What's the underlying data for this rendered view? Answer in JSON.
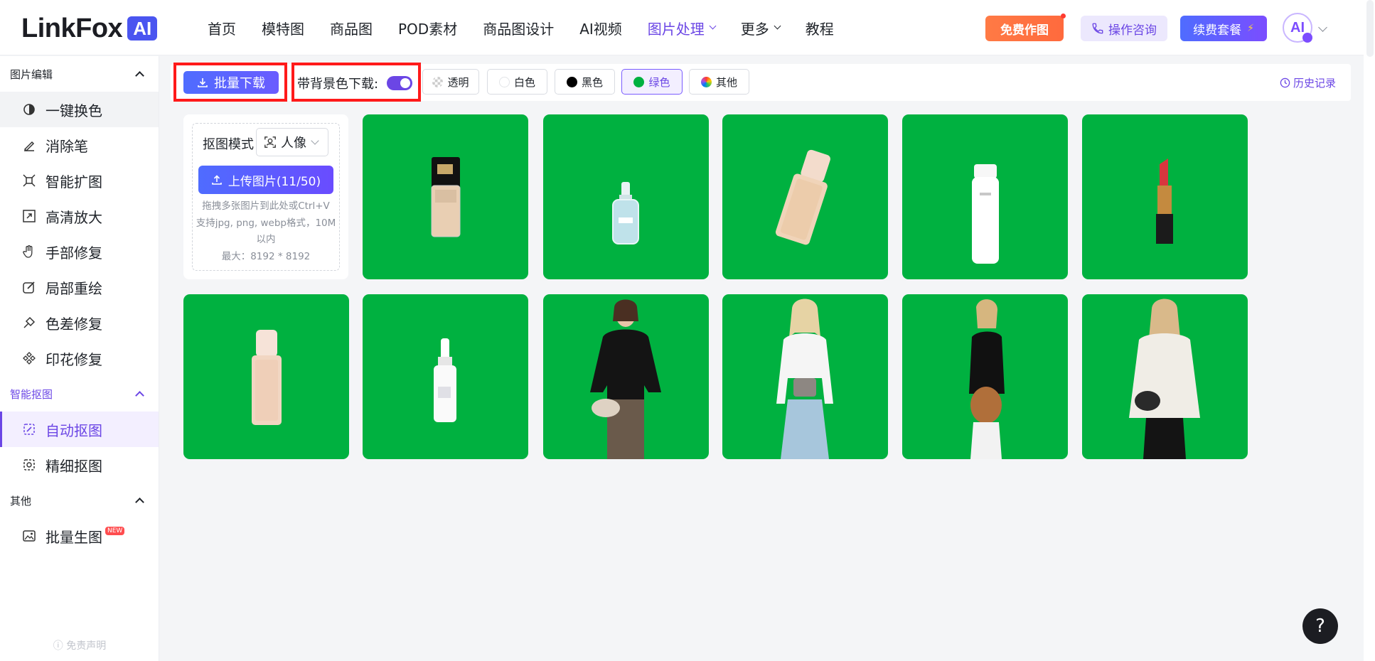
{
  "brand": {
    "name": "LinkFox",
    "badge": "AI"
  },
  "nav": [
    {
      "label": "首页"
    },
    {
      "label": "模特图"
    },
    {
      "label": "商品图"
    },
    {
      "label": "POD素材"
    },
    {
      "label": "商品图设计"
    },
    {
      "label": "AI视频"
    },
    {
      "label": "图片处理",
      "active": true,
      "dropdown": true
    },
    {
      "label": "更多",
      "dropdown": true
    },
    {
      "label": "教程"
    }
  ],
  "header_buttons": {
    "free": "免费作图",
    "consult": "操作咨询",
    "renew": "续费套餐",
    "renew_icon": "⚡"
  },
  "avatar": {
    "initials": "AI"
  },
  "sidebar": {
    "groups": [
      {
        "title": "图片编辑",
        "items": [
          {
            "label": "一键换色",
            "icon": "color-swap-icon",
            "selected": true
          },
          {
            "label": "消除笔",
            "icon": "eraser-pen-icon"
          },
          {
            "label": "智能扩图",
            "icon": "expand-icon"
          },
          {
            "label": "高清放大",
            "icon": "upscale-icon"
          },
          {
            "label": "手部修复",
            "icon": "hand-icon"
          },
          {
            "label": "局部重绘",
            "icon": "brush-icon"
          },
          {
            "label": "色差修复",
            "icon": "color-fix-icon"
          },
          {
            "label": "印花修复",
            "icon": "pattern-icon"
          }
        ]
      },
      {
        "title": "智能抠图",
        "accent": true,
        "items": [
          {
            "label": "自动抠图",
            "icon": "auto-cutout-icon",
            "active": true
          },
          {
            "label": "精细抠图",
            "icon": "fine-cutout-icon"
          }
        ]
      },
      {
        "title": "其他",
        "items": [
          {
            "label": "批量生图",
            "icon": "batch-image-icon",
            "badge": "NEW"
          }
        ]
      }
    ],
    "disclaimer": "ⓘ 免责声明"
  },
  "toolbar": {
    "batch_download": "批量下载",
    "bg_download_label": "带背景色下载:",
    "bg_download_on": true,
    "bg_options": [
      {
        "label": "透明",
        "swatch": "checker"
      },
      {
        "label": "白色",
        "swatch": "#ffffff"
      },
      {
        "label": "黑色",
        "swatch": "#000000"
      },
      {
        "label": "绿色",
        "swatch": "#00b140",
        "selected": true
      },
      {
        "label": "其他",
        "swatch": "rainbow"
      }
    ],
    "history": "历史记录"
  },
  "upload": {
    "mode_label": "抠图模式",
    "mode_value": "人像",
    "button": "上传图片(11/50)",
    "hint_lines": [
      "拖拽多张图片到此处或Ctrl+V",
      "支持jpg, png, webp格式，10M",
      "以内",
      "最大：8192 * 8192"
    ]
  },
  "results": {
    "background_color": "#00b140",
    "images": [
      {
        "subject": "foundation-bottle-black-cap"
      },
      {
        "subject": "serum-dropper-bottle"
      },
      {
        "subject": "foundation-bottle-tilted"
      },
      {
        "subject": "white-lotion-bottle"
      },
      {
        "subject": "red-lipstick"
      },
      {
        "subject": "foundation-bottle-pink"
      },
      {
        "subject": "serum-dropper-white"
      },
      {
        "subject": "model-black-top-crossbody-bag"
      },
      {
        "subject": "model-white-top-blue-skirt"
      },
      {
        "subject": "model-black-top-brown-bag"
      },
      {
        "subject": "model-white-shirt-black-bag"
      }
    ]
  },
  "help_button": "?"
}
